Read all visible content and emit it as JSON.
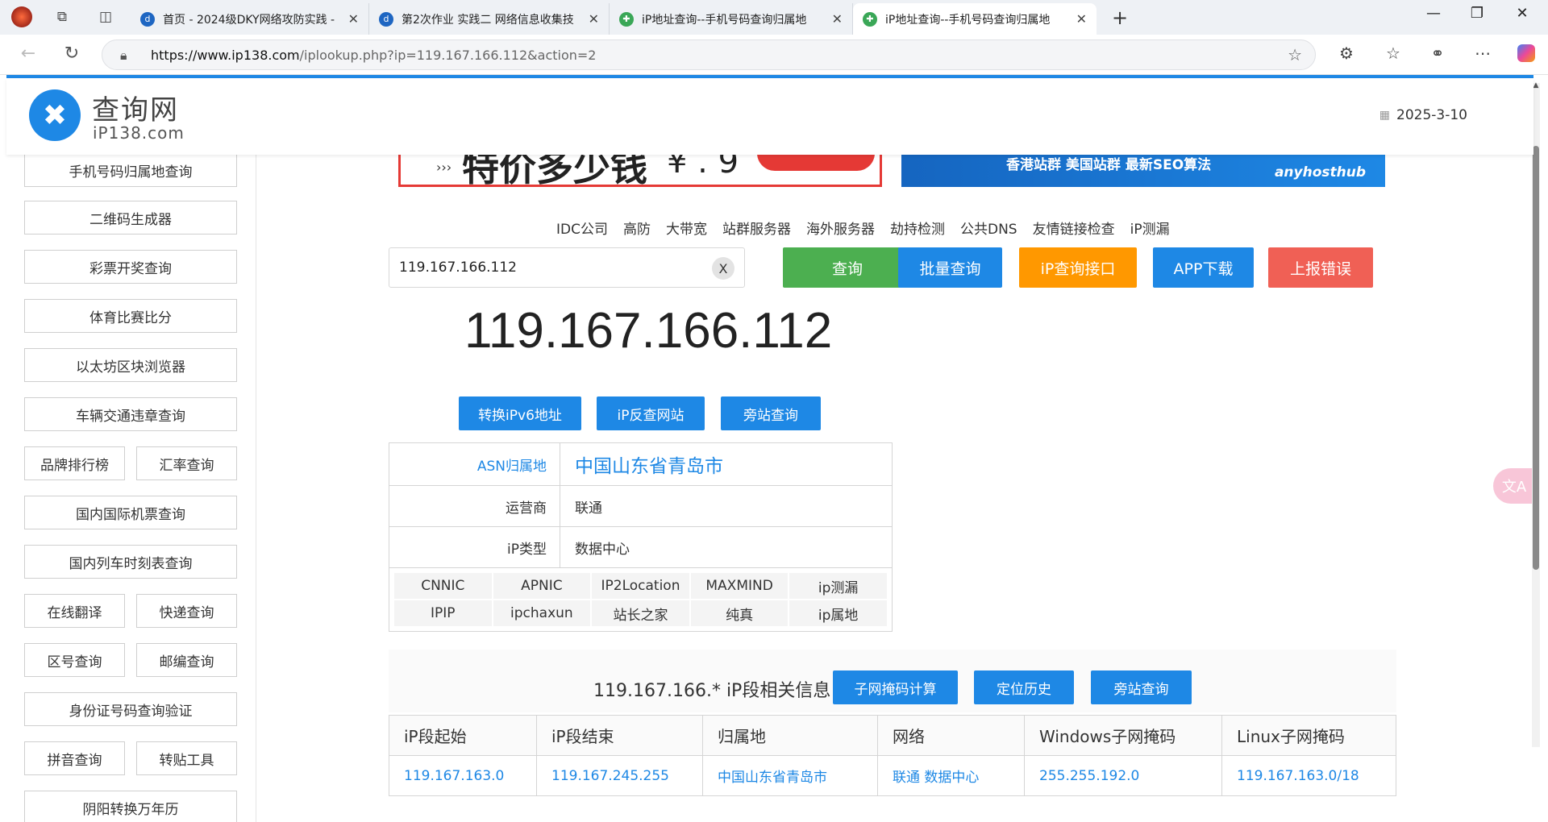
{
  "browser": {
    "tabs": [
      {
        "title": "首页 - 2024级DKY网络攻防实践 -",
        "fav_color": "#1e66c2"
      },
      {
        "title": "第2次作业 实践二 网络信息收集技",
        "fav_color": "#1e66c2"
      },
      {
        "title": "iP地址查询--手机号码查询归属地",
        "fav_color": "#3aa757"
      },
      {
        "title": "iP地址查询--手机号码查询归属地",
        "fav_color": "#3aa757"
      }
    ],
    "url_host": "https://www.ip138.com",
    "url_rest": "/iplookup.php?ip=119.167.166.112&action=2"
  },
  "header": {
    "logo_cn": "查询网",
    "logo_en": "iP138.com",
    "date": "2025-3-10"
  },
  "sidebar": {
    "single": [
      "手机号码归属地查询",
      "二维码生成器",
      "彩票开奖查询",
      "体育比赛比分",
      "以太坊区块浏览器",
      "车辆交通违章查询"
    ],
    "pair1": [
      "品牌排行榜",
      "汇率查询"
    ],
    "single2": [
      "国内国际机票查询",
      "国内列车时刻表查询"
    ],
    "pair2": [
      "在线翻译",
      "快递查询"
    ],
    "pair3": [
      "区号查询",
      "邮编查询"
    ],
    "single3": [
      "身份证号码查询验证"
    ],
    "pair4": [
      "拼音查询",
      "转贴工具"
    ],
    "single4": [
      "阴阳转换万年历"
    ]
  },
  "banners": {
    "left_text": "特价多少钱",
    "left_arrow": "›››",
    "left_price": "¥ . 9",
    "right_text": "香港站群 美国站群 最新SEO算法",
    "right_brand": "anyhosthub"
  },
  "toplinks": [
    "IDC公司",
    "高防",
    "大带宽",
    "站群服务器",
    "海外服务器",
    "劫持检测",
    "公共DNS",
    "友情链接检查",
    "iP测漏"
  ],
  "search": {
    "value": "119.167.166.112",
    "clear": "X",
    "buttons": [
      {
        "label": "查询",
        "color": "#4caf50"
      },
      {
        "label": "批量查询",
        "color": "#1e88e5"
      },
      {
        "label": "iP查询接口",
        "color": "#ff9800"
      },
      {
        "label": "APP下载",
        "color": "#1e88e5"
      },
      {
        "label": "上报错误",
        "color": "#f06055"
      }
    ]
  },
  "result": {
    "ip": "119.167.166.112",
    "buttons": [
      "转换iPv6地址",
      "iP反查网站",
      "旁站查询"
    ],
    "rows": [
      {
        "key": "ASN归属地",
        "value": "中国山东省青岛市"
      },
      {
        "key": "运营商",
        "value": "联通"
      },
      {
        "key": "iP类型",
        "value": "数据中心"
      }
    ],
    "sources": [
      "CNNIC",
      "APNIC",
      "IP2Location",
      "MAXMIND",
      "ip测漏",
      "IPIP",
      "ipchaxun",
      "站长之家",
      "纯真",
      "ip属地"
    ]
  },
  "segment": {
    "title": "119.167.166.* iP段相关信息",
    "buttons": [
      "子网掩码计算",
      "定位历史",
      "旁站查询"
    ],
    "headers": [
      "iP段起始",
      "iP段结束",
      "归属地",
      "网络",
      "Windows子网掩码",
      "Linux子网掩码"
    ],
    "row": [
      "119.167.163.0",
      "119.167.245.255",
      "中国山东省青岛市",
      "联通 数据中心",
      "255.255.192.0",
      "119.167.163.0/18"
    ]
  },
  "colors": {
    "accent": "#1e88e5"
  }
}
